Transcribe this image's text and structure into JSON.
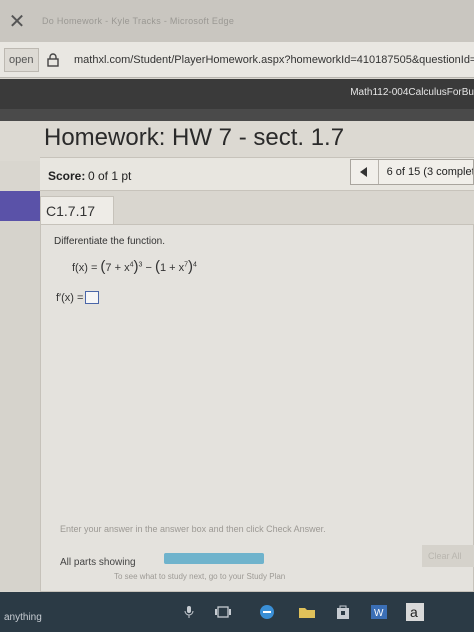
{
  "browser": {
    "tab_title": "Do Homework - Kyle Tracks - Microsoft Edge",
    "open_label": "open",
    "url": "mathxl.com/Student/PlayerHomework.aspx?homeworkId=410187505&questionId=3&"
  },
  "course": {
    "title": "Math112-004CalculusForBu"
  },
  "homework": {
    "title": "Homework: HW 7 - sect. 1.7"
  },
  "score": {
    "label": "Score:",
    "value": "0 of 1 pt"
  },
  "navigation": {
    "question_count": "6 of 15 (3 complete"
  },
  "question": {
    "label": "C1.7.17",
    "instruction": "Differentiate the function.",
    "fx_lhs": "f(x) = ",
    "term1_base": "7 + x",
    "term1_inner_exp": "4",
    "term1_outer_exp": "3",
    "minus": " − ",
    "term2_base": "1 + x",
    "term2_inner_exp": "7",
    "term2_outer_exp": "4",
    "answer_label": "f′(x) ="
  },
  "footer": {
    "hint": "Enter your answer in the answer box and then click Check Answer.",
    "parts_label": "All parts showing",
    "clear_all_label": "Clear All",
    "progress_fraction": 1.0,
    "cut_text": "To see what to study next, go to your Study Plan"
  },
  "taskbar": {
    "search_text": "anything"
  },
  "colors": {
    "accent_strip": "#5a52a8",
    "course_header": "#3a3a3a",
    "taskbar": "#2b3a45",
    "progress": "#a8d2e0"
  }
}
